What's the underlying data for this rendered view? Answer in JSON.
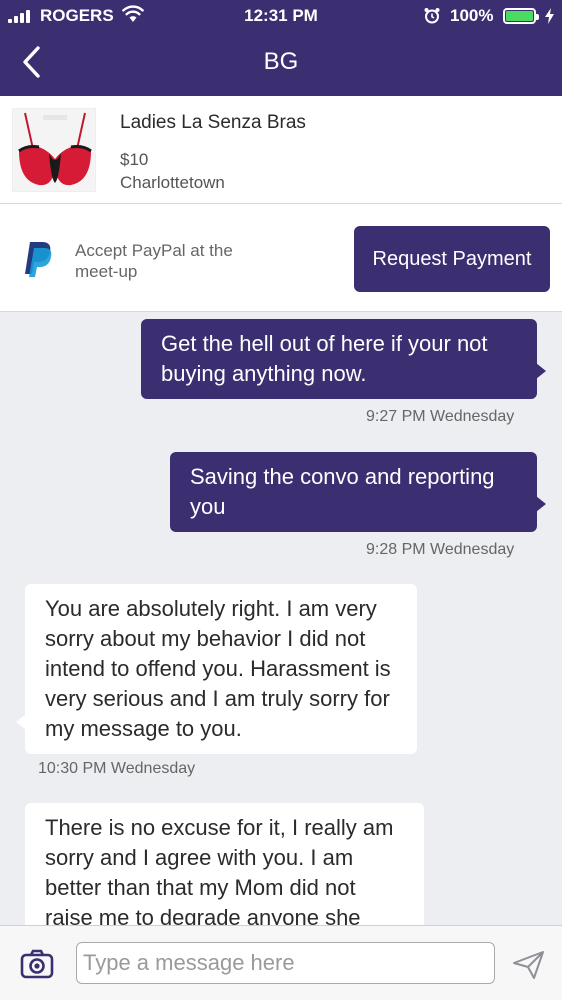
{
  "status": {
    "carrier": "ROGERS",
    "time": "12:31 PM",
    "battery": "100%",
    "battery_color": "#4cd964"
  },
  "header": {
    "title": "BG",
    "back_icon": "chevron-left-icon"
  },
  "listing": {
    "title": "Ladies La Senza Bras",
    "price": "$10",
    "location": "Charlottetown"
  },
  "paypal": {
    "text": "Accept PayPal at the meet-up",
    "button_label": "Request Payment",
    "logo_icon": "paypal-icon"
  },
  "messages": [
    {
      "direction": "outgoing",
      "text": "Get the hell out of here if your not buying anything now.",
      "timestamp": "9:27 PM Wednesday"
    },
    {
      "direction": "outgoing",
      "text": "Saving the convo and reporting you",
      "timestamp": "9:28 PM Wednesday"
    },
    {
      "direction": "incoming",
      "text": "You are absolutely right. I am very sorry about my behavior I did not intend to offend you. Harassment is very serious and I am truly sorry for my message to you.",
      "timestamp": "10:30 PM Wednesday"
    },
    {
      "direction": "incoming",
      "text": "There is no excuse for it, I really am sorry and I agree with you. I am better than that my Mom did not raise me to degrade anyone she",
      "timestamp": ""
    }
  ],
  "composer": {
    "placeholder": "Type a message here",
    "camera_icon": "camera-icon",
    "send_icon": "send-icon"
  },
  "colors": {
    "brand": "#3b2f72",
    "background": "#eceef1"
  }
}
